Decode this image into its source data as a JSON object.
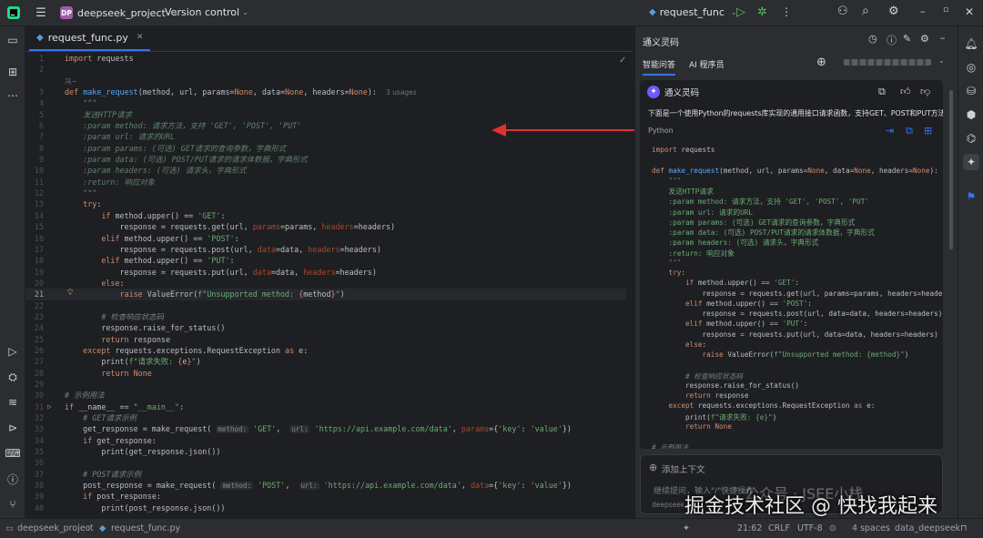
{
  "titlebar": {
    "project_badge": "DP",
    "project_name": "deepseek_project",
    "vcs": "Version control",
    "run_config": "request_func"
  },
  "editor": {
    "tab_label": "request_func.py",
    "lines": [
      {
        "n": "1",
        "html": "<span class='k'>import</span> requests"
      },
      {
        "n": "2",
        "html": ""
      },
      {
        "n": "",
        "html": "<span class='usg'>冯~</span>"
      },
      {
        "n": "3",
        "html": "<span class='k'>def</span> <span class='fn'>make_request</span>(method, url, params=<span class='k'>None</span>, data=<span class='k'>None</span>, headers=<span class='k'>None</span>):  <span class='usg'>3 usages</span>"
      },
      {
        "n": "4",
        "html": "    <span class='dc'>\"\"\"</span>"
      },
      {
        "n": "5",
        "html": "    <span class='dc'>发送HTTP请求</span>"
      },
      {
        "n": "6",
        "html": "    <span class='dc'>:param method: 请求方法，支持 'GET', 'POST', 'PUT'</span>"
      },
      {
        "n": "7",
        "html": "    <span class='dc'>:param url: 请求的URL</span>"
      },
      {
        "n": "8",
        "html": "    <span class='dc'>:param params: (可选) GET请求的查询参数，字典形式</span>"
      },
      {
        "n": "9",
        "html": "    <span class='dc'>:param data: (可选) POST/PUT请求的请求体数据，字典形式</span>"
      },
      {
        "n": "10",
        "html": "    <span class='dc'>:param headers: (可选) 请求头，字典形式</span>"
      },
      {
        "n": "11",
        "html": "    <span class='dc'>:return: 响应对象</span>"
      },
      {
        "n": "12",
        "html": "    <span class='dc'>\"\"\"</span>"
      },
      {
        "n": "13",
        "html": "    <span class='k'>try</span>:"
      },
      {
        "n": "14",
        "html": "        <span class='k'>if</span> method.upper() == <span class='s'>'GET'</span>:"
      },
      {
        "n": "15",
        "html": "            response = requests.get(url, <span class='pm'>params</span>=params, <span class='pm'>headers</span>=headers)"
      },
      {
        "n": "16",
        "html": "        <span class='k'>elif</span> method.upper() == <span class='s'>'POST'</span>:"
      },
      {
        "n": "17",
        "html": "            response = requests.post(url, <span class='pm'>data</span>=data, <span class='pm'>headers</span>=headers)"
      },
      {
        "n": "18",
        "html": "        <span class='k'>elif</span> method.upper() == <span class='s'>'PUT'</span>:"
      },
      {
        "n": "19",
        "html": "            response = requests.put(url, <span class='pm'>data</span>=data, <span class='pm'>headers</span>=headers)"
      },
      {
        "n": "20",
        "html": "        <span class='k'>else</span>:"
      },
      {
        "n": "21",
        "html": "            <span class='k'>raise</span> ValueError(<span class='s'>f\"Unsupported method: </span><span class='k'>{</span>method<span class='k'>}</span><span class='s'>\"</span>)",
        "cur": true
      },
      {
        "n": "22",
        "html": ""
      },
      {
        "n": "23",
        "html": "        <span class='c'># 检查响应状态码</span>"
      },
      {
        "n": "24",
        "html": "        response.raise_for_status()"
      },
      {
        "n": "25",
        "html": "        <span class='k'>return</span> response"
      },
      {
        "n": "26",
        "html": "    <span class='k'>except</span> requests.exceptions.RequestException <span class='k'>as</span> e:"
      },
      {
        "n": "27",
        "html": "        print(<span class='s'>f\"请求失败: </span><span class='k'>{</span>e<span class='k'>}</span><span class='s'>\"</span>)"
      },
      {
        "n": "28",
        "html": "        <span class='k'>return None</span>"
      },
      {
        "n": "29",
        "html": ""
      },
      {
        "n": "30",
        "html": "<span class='c'># 示例用法</span>"
      },
      {
        "n": "31",
        "html": "<span class='k'>if</span> __name__ == <span class='s'>\"__main__\"</span>:"
      },
      {
        "n": "32",
        "html": "    <span class='c'># GET请求示例</span>"
      },
      {
        "n": "33",
        "html": "    get_response = make_request( <span class='hint'>method:</span> <span class='s'>'GET'</span>,  <span class='hint'>url:</span> <span class='s'>'https://api.example.com/data'</span>, <span class='pm'>params</span>={<span class='s'>'key'</span>: <span class='s'>'value'</span>})"
      },
      {
        "n": "34",
        "html": "    <span class='k'>if</span> get_response:"
      },
      {
        "n": "35",
        "html": "        print(get_response.json())"
      },
      {
        "n": "36",
        "html": ""
      },
      {
        "n": "37",
        "html": "    <span class='c'># POST请求示例</span>"
      },
      {
        "n": "38",
        "html": "    post_response = make_request( <span class='hint'>method:</span> <span class='s'>'POST'</span>,  <span class='hint'>url:</span> <span class='s'>'https://api.example.com/data'</span>, <span class='pm'>data</span>={<span class='s'>'key'</span>: <span class='s'>'value'</span>})"
      },
      {
        "n": "39",
        "html": "    <span class='k'>if</span> post_response:"
      },
      {
        "n": "40",
        "html": "        print(post_response.json())"
      }
    ]
  },
  "assistant": {
    "panel_title": "通义灵码",
    "tab_qa": "智能问答",
    "tab_agent": "AI 程序员",
    "bot_name": "通义灵码",
    "intro": "下面是一个使用Python的requests库实现的通用接口请求函数，支持GET、POST和PUT方法：",
    "code_lang": "Python",
    "code_lines": [
      "<span class='k'>import</span> requests",
      "",
      "<span class='k'>def</span> <span class='fn'>make_request</span>(method, url, params=<span class='k'>None</span>, data=<span class='k'>None</span>, headers=<span class='k'>None</span>):",
      "    <span class='dc'>\"\"\"</span>",
      "    <span class='s'>发送HTTP请求</span>",
      "    <span class='s'>:param method: 请求方法，支持 'GET', 'POST', 'PUT'</span>",
      "    <span class='s'>:param url: 请求的URL</span>",
      "    <span class='s'>:param params: (可选) GET请求的查询参数，字典形式</span>",
      "    <span class='s'>:param data: (可选) POST/PUT请求的请求体数据，字典形式</span>",
      "    <span class='s'>:param headers: (可选) 请求头，字典形式</span>",
      "    <span class='s'>:return: 响应对象</span>",
      "    <span class='dc'>\"\"\"</span>",
      "    <span class='k'>try</span>:",
      "        <span class='k'>if</span> method.upper() == <span class='s'>'GET'</span>:",
      "            response = requests.get(url, params=params, headers=headers)",
      "        <span class='k'>elif</span> method.upper() == <span class='s'>'POST'</span>:",
      "            response = requests.post(url, data=data, headers=headers)",
      "        <span class='k'>elif</span> method.upper() == <span class='s'>'PUT'</span>:",
      "            response = requests.put(url, data=data, headers=headers)",
      "        <span class='k'>else</span>:",
      "            <span class='k'>raise</span> ValueError(<span class='s'>f\"Unsupported method: {method}\"</span>)",
      "",
      "        <span class='c'># 检查响应状态码</span>",
      "        response.raise_for_status()",
      "        <span class='k'>return</span> response",
      "    <span class='k'>except</span> requests.exceptions.RequestException <span class='k'>as</span> e:",
      "        print(<span class='s'>f\"请求失败: {e}\"</span>)",
      "        <span class='k'>return None</span>",
      "",
      "<span class='c'># 示例用法</span>"
    ],
    "input_placeholder": "添加上下文",
    "input_hint": "继续提问，输入\"/\"快捷操作",
    "model": "deepseek"
  },
  "statusbar": {
    "project": "deepseek_project",
    "file": "request_func.py",
    "position": "21:62",
    "line_sep": "CRLF",
    "encoding": "UTF-8",
    "indent": "4 spaces",
    "interpreter": "data_deepseek"
  },
  "watermark": {
    "main": "掘金技术社区 @ 快找我起来",
    "faint": "公众号 · JSEE小栈"
  },
  "colors": {
    "arrow": "#e0312f",
    "accent": "#3574f0"
  }
}
